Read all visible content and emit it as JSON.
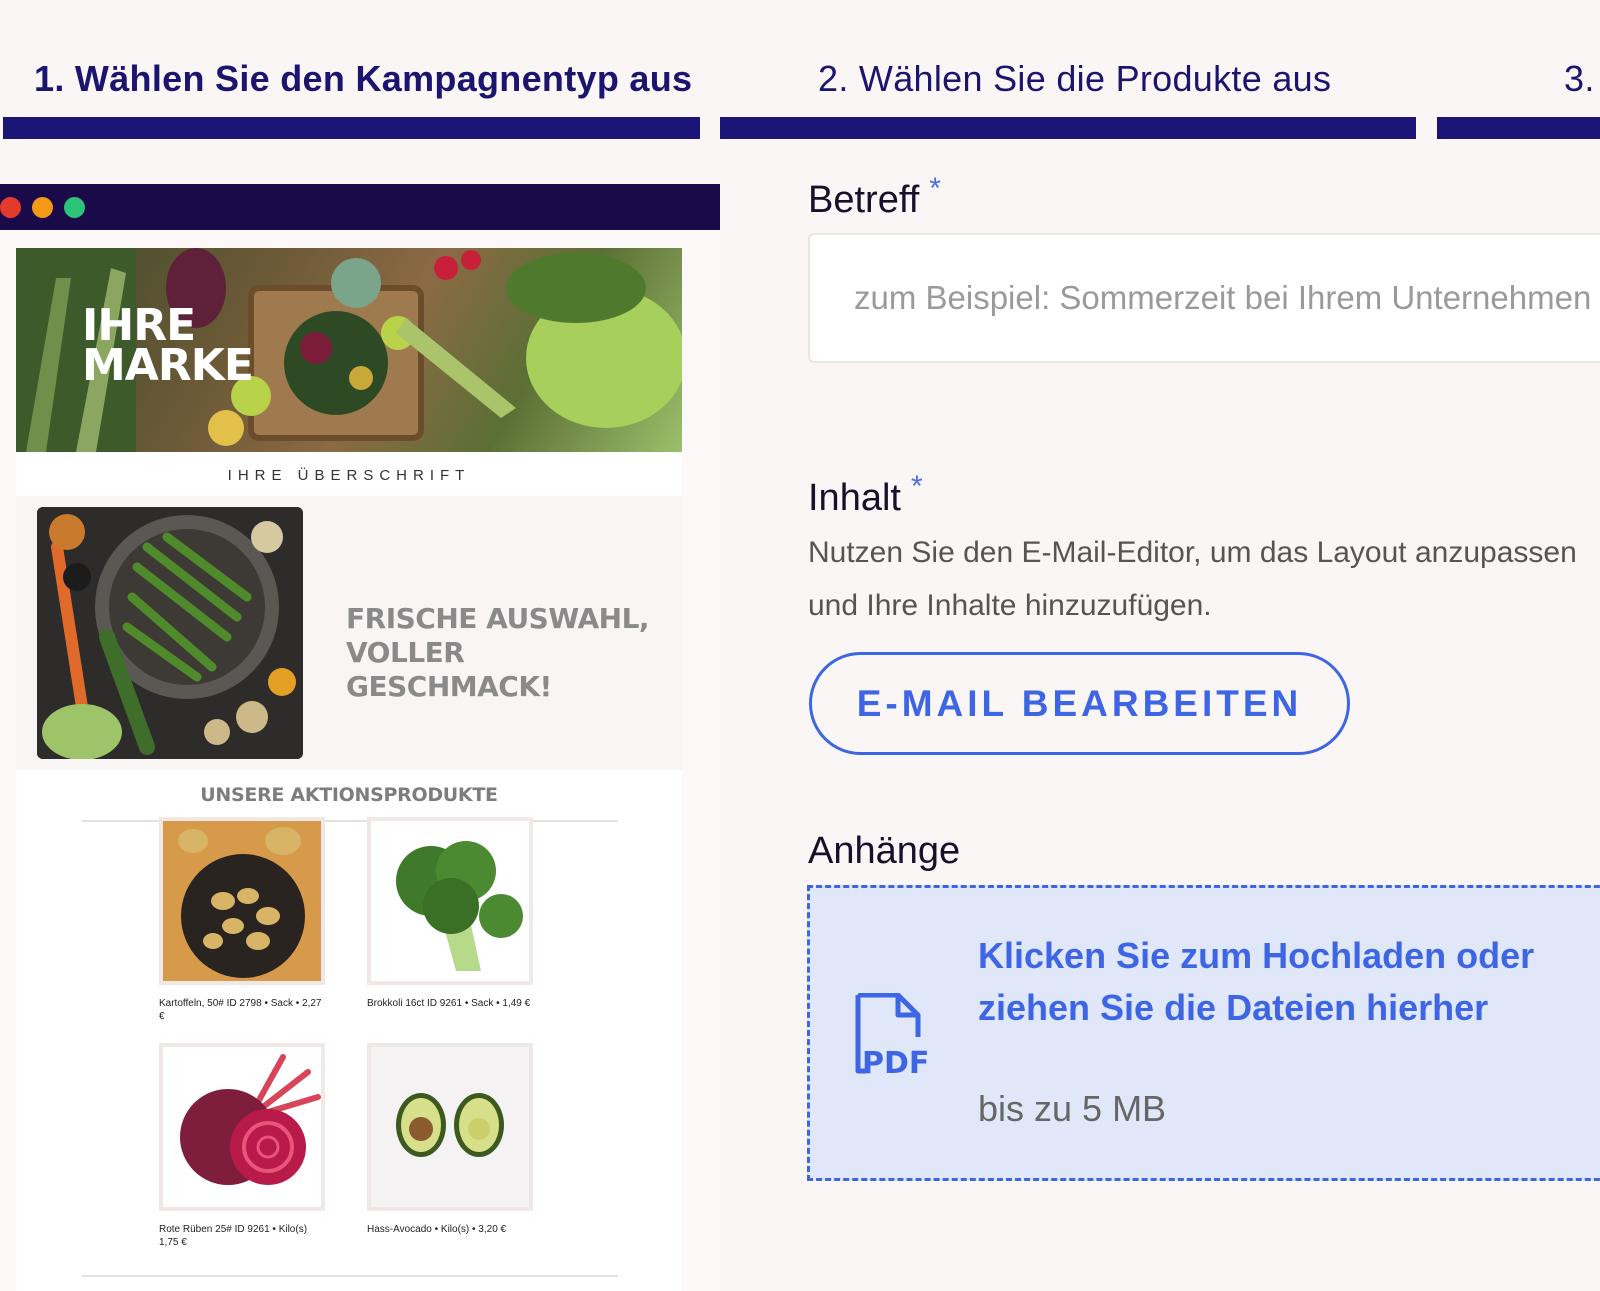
{
  "stepper": {
    "steps": [
      {
        "label": "1. Wählen Sie den Kampagnentyp aus",
        "active": true
      },
      {
        "label": "2. Wählen Sie die Produkte aus",
        "active": false
      },
      {
        "label": "3.",
        "active": false
      }
    ]
  },
  "preview": {
    "window_dots": [
      "#e23a2b",
      "#f59a17",
      "#2cc27a"
    ],
    "brand_line1": "IHRE",
    "brand_line2": "MARKE",
    "overline": "IHRE ÜBERSCHRIFT",
    "feature_title": "FRISCHE AUSWAHL, VOLLER GESCHMACK!",
    "products_title": "UNSERE AKTIONSPRODUKTE",
    "products": [
      {
        "caption": "Kartoffeln, 50# ID 2798 • Sack • 2,27 €",
        "image": "potatoes-image"
      },
      {
        "caption": "Brokkoli 16ct ID 9261 • Sack • 1,49 €",
        "image": "broccoli-image"
      },
      {
        "caption": "Rote Rüben 25# ID 9261 • Kilo(s) 1,75 €",
        "image": "beetroot-image"
      },
      {
        "caption": "Hass-Avocado • Kilo(s) • 3,20 €",
        "image": "avocado-image"
      }
    ]
  },
  "form": {
    "subject_label": "Betreff",
    "subject_required": "*",
    "subject_placeholder": "zum Beispiel: Sommerzeit bei Ihrem Unternehmen",
    "subject_value": "",
    "content_label": "Inhalt",
    "content_required": "*",
    "content_help": "Nutzen Sie den E-Mail-Editor, um das Layout anzupassen und Ihre Inhalte hinzuzufügen.",
    "edit_button": "E-MAIL BEARBEITEN",
    "attachments_label": "Anhänge",
    "drop_text": "Klicken Sie zum Hochladen oder ziehen Sie die Dateien hierher",
    "drop_limit": "bis zu 5 MB",
    "pdf_icon_text": "PDF"
  },
  "colors": {
    "navy": "#1a1577",
    "accent": "#3e65e3",
    "drop_bg": "#dfe7f8",
    "window_bar": "#1b0a49"
  }
}
